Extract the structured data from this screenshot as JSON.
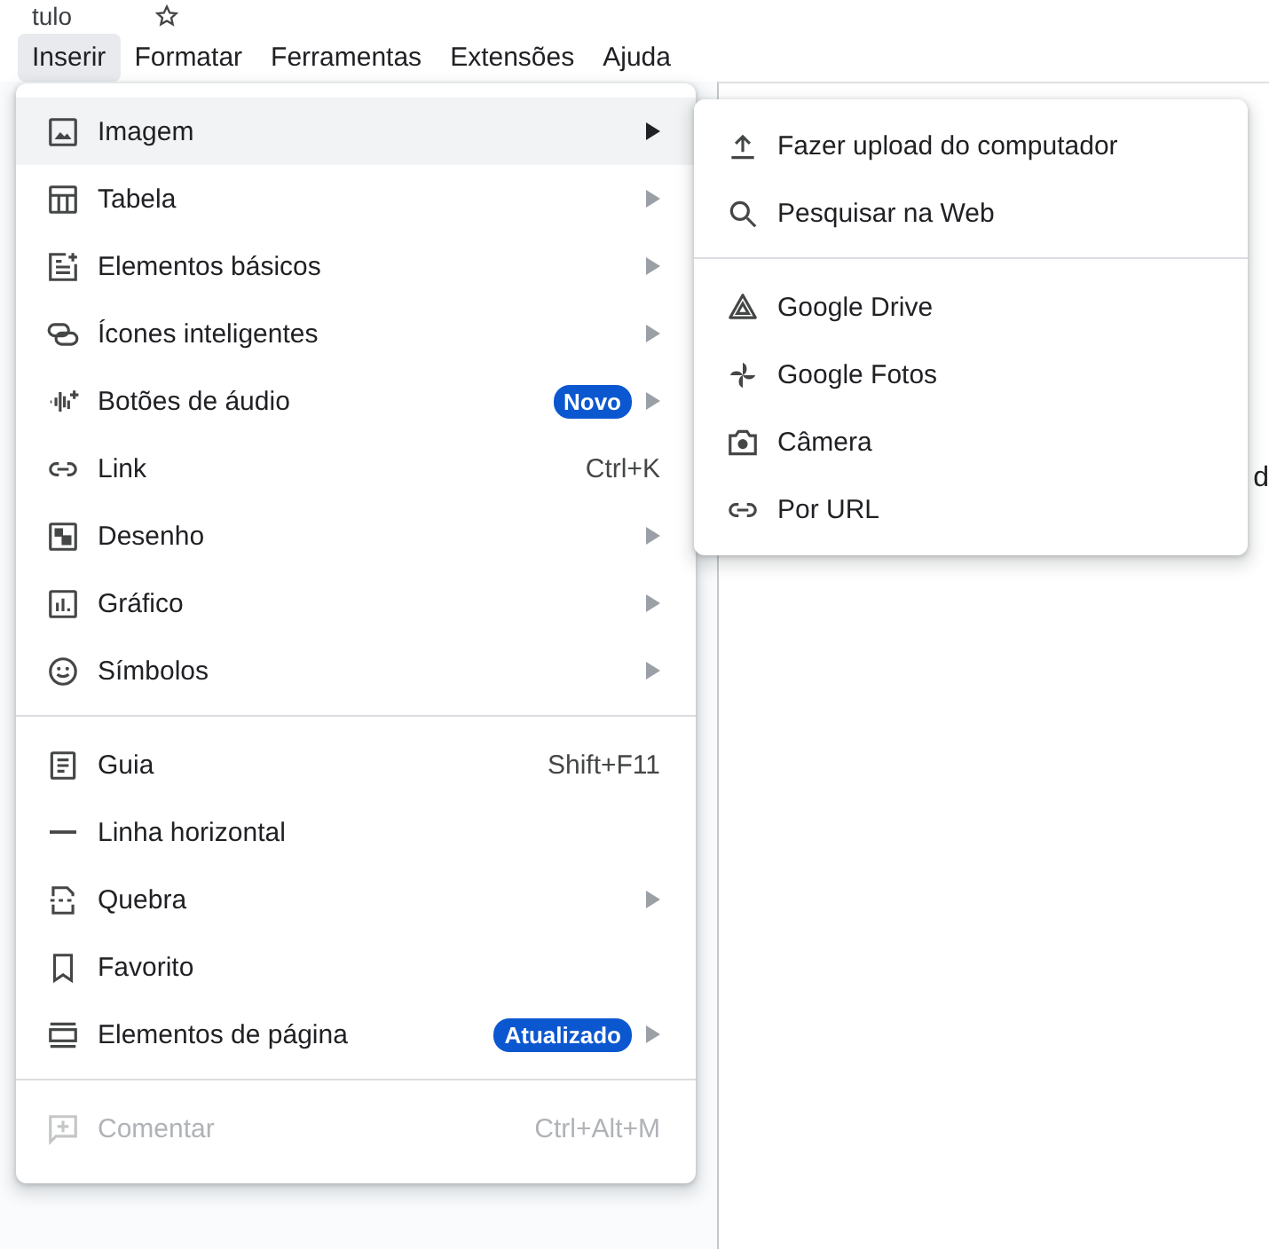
{
  "doc_title": "tulo",
  "menubar": [
    {
      "label": "Inserir",
      "selected": true
    },
    {
      "label": "Formatar",
      "selected": false
    },
    {
      "label": "Ferramentas",
      "selected": false
    },
    {
      "label": "Extensões",
      "selected": false
    },
    {
      "label": "Ajuda",
      "selected": false
    }
  ],
  "document_fragment": "d",
  "insert_menu": {
    "sections": [
      [
        {
          "label": "Imagem",
          "selected": true,
          "submenu": true,
          "disabled": false
        },
        {
          "label": "Tabela",
          "selected": false,
          "submenu": true,
          "disabled": false
        },
        {
          "label": "Elementos básicos",
          "selected": false,
          "submenu": true,
          "disabled": false
        },
        {
          "label": "Ícones inteligentes",
          "selected": false,
          "submenu": true,
          "disabled": false
        },
        {
          "label": "Botões de áudio",
          "badge": "Novo",
          "selected": false,
          "submenu": true,
          "disabled": false
        },
        {
          "label": "Link",
          "shortcut": "Ctrl+K",
          "selected": false,
          "submenu": false,
          "disabled": false
        },
        {
          "label": "Desenho",
          "selected": false,
          "submenu": true,
          "disabled": false
        },
        {
          "label": "Gráfico",
          "selected": false,
          "submenu": true,
          "disabled": false
        },
        {
          "label": "Símbolos",
          "selected": false,
          "submenu": true,
          "disabled": false
        }
      ],
      [
        {
          "label": "Guia",
          "shortcut": "Shift+F11",
          "selected": false,
          "submenu": false,
          "disabled": false
        },
        {
          "label": "Linha horizontal",
          "selected": false,
          "submenu": false,
          "disabled": false
        },
        {
          "label": "Quebra",
          "selected": false,
          "submenu": true,
          "disabled": false
        },
        {
          "label": "Favorito",
          "selected": false,
          "submenu": false,
          "disabled": false
        },
        {
          "label": "Elementos de página",
          "badge": "Atualizado",
          "selected": false,
          "submenu": true,
          "disabled": false
        }
      ],
      [
        {
          "label": "Comentar",
          "shortcut": "Ctrl+Alt+M",
          "selected": false,
          "submenu": false,
          "disabled": true
        }
      ]
    ]
  },
  "image_submenu": {
    "sections": [
      [
        {
          "label": "Fazer upload do computador"
        },
        {
          "label": "Pesquisar na Web"
        }
      ],
      [
        {
          "label": "Google Drive"
        },
        {
          "label": "Google Fotos"
        },
        {
          "label": "Câmera"
        },
        {
          "label": "Por URL"
        }
      ]
    ]
  }
}
